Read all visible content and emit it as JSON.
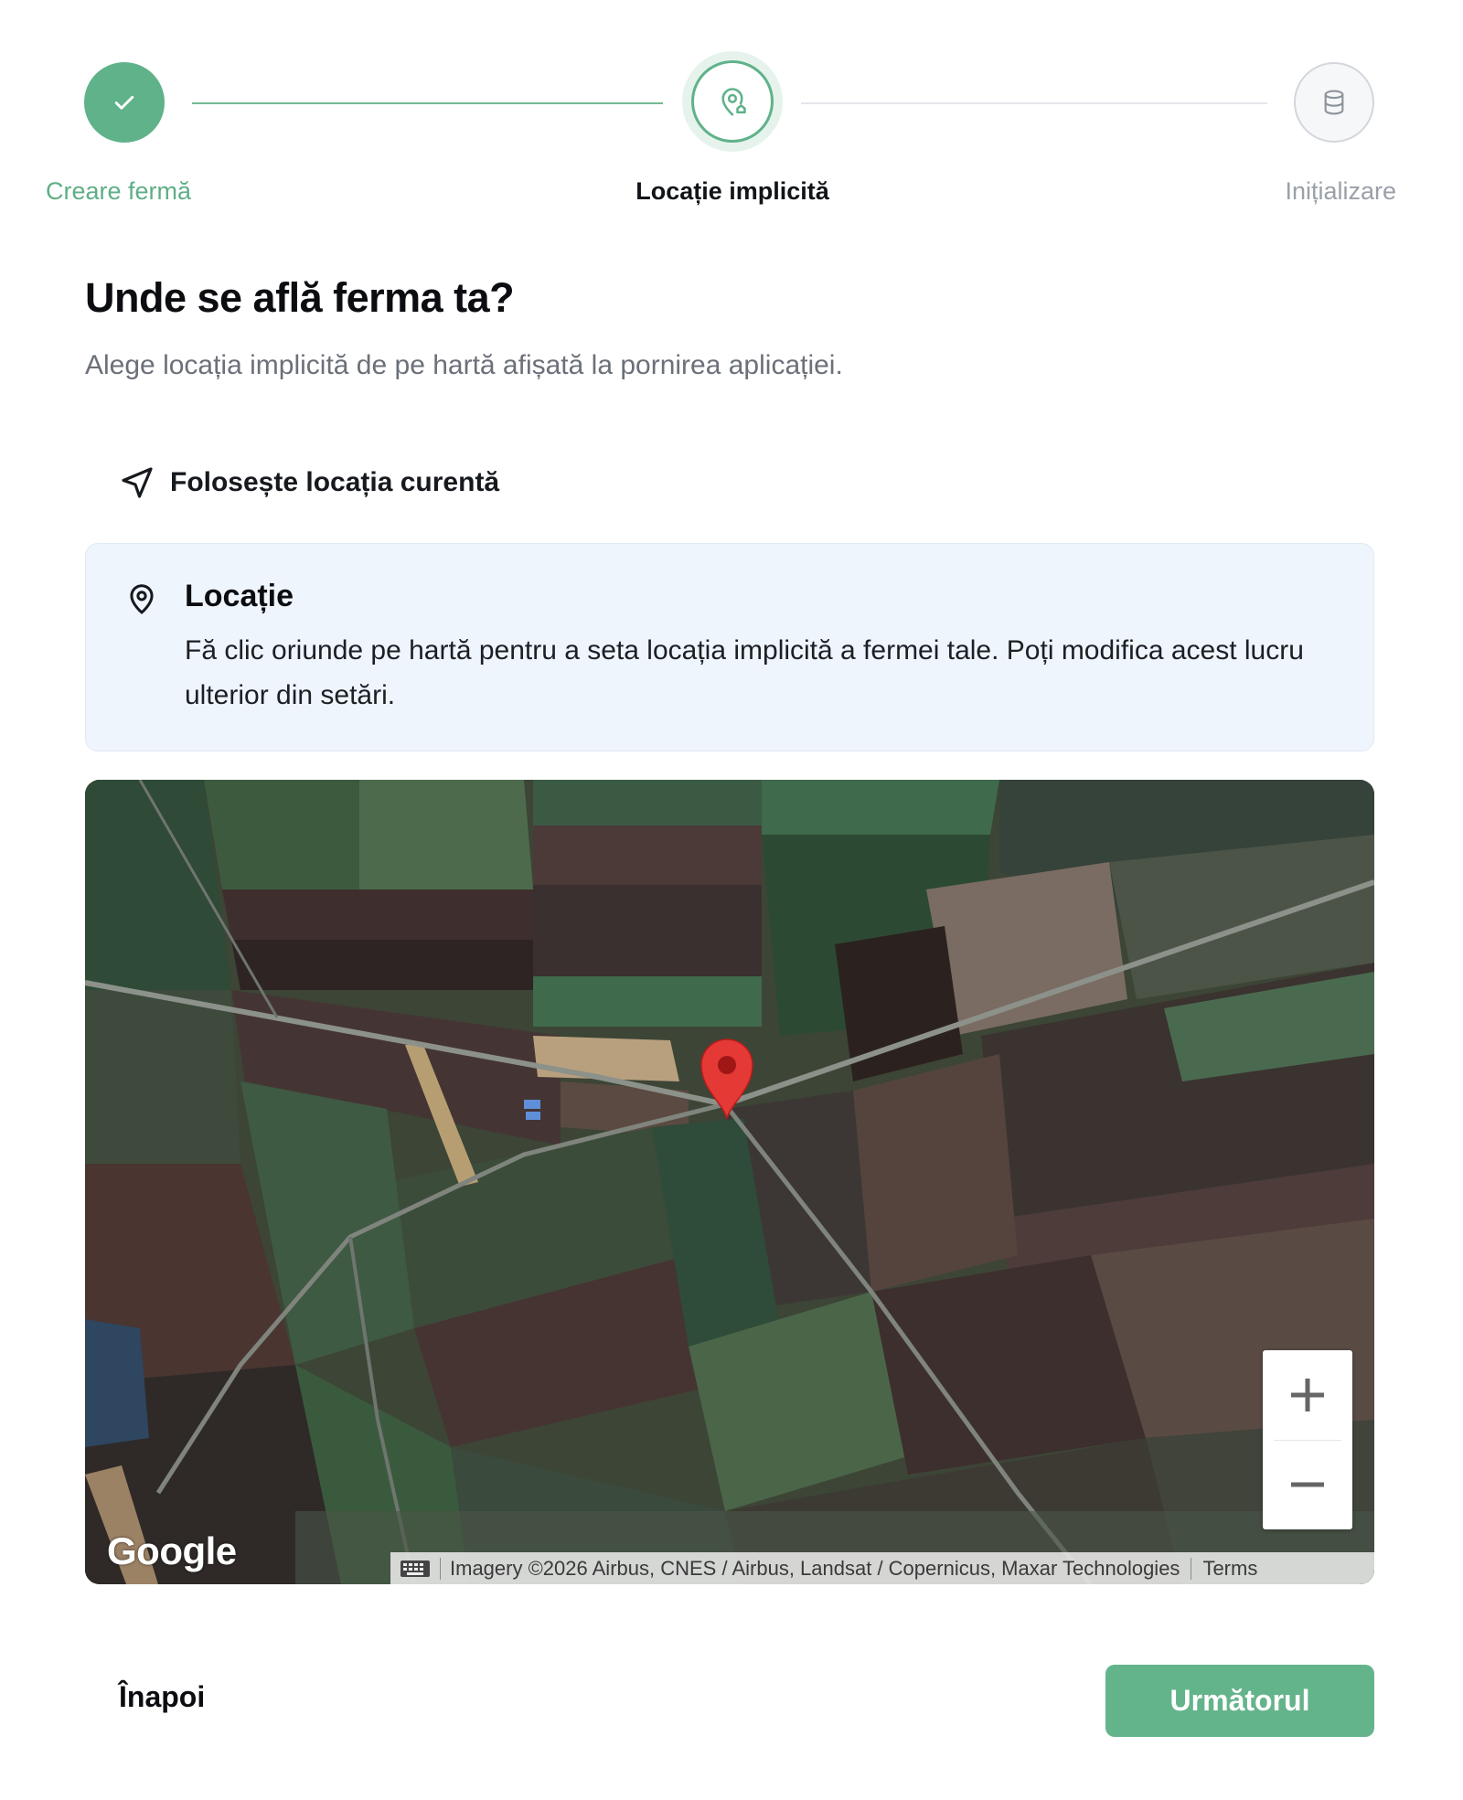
{
  "stepper": {
    "steps": [
      {
        "label": "Creare fermă",
        "status": "completed"
      },
      {
        "label": "Locație implicită",
        "status": "active"
      },
      {
        "label": "Inițializare",
        "status": "pending"
      }
    ]
  },
  "header": {
    "title": "Unde se află ferma ta?",
    "subtitle": "Alege locația implicită de pe hartă afișată la pornirea aplicației."
  },
  "current_location": {
    "label": "Folosește locația curentă",
    "icon": "navigation-arrow-icon"
  },
  "info_box": {
    "icon": "map-pin-icon",
    "title": "Locație",
    "text": "Fă clic oriunde pe hartă pentru a seta locația implicită a fermei tale. Poți modifica acest lucru ulterior din setări."
  },
  "map": {
    "type": "satellite",
    "logo": "Google",
    "attribution": "Imagery ©2026 Airbus, CNES / Airbus, Landsat / Copernicus, Maxar Technologies",
    "terms": "Terms",
    "zoom_in": "+",
    "zoom_out": "−"
  },
  "footer": {
    "back_label": "Înapoi",
    "next_label": "Următorul"
  },
  "colors": {
    "accent": "#5fb289",
    "next_button": "#64b48b",
    "info_bg": "#eff5fd",
    "marker": "#e53935"
  }
}
